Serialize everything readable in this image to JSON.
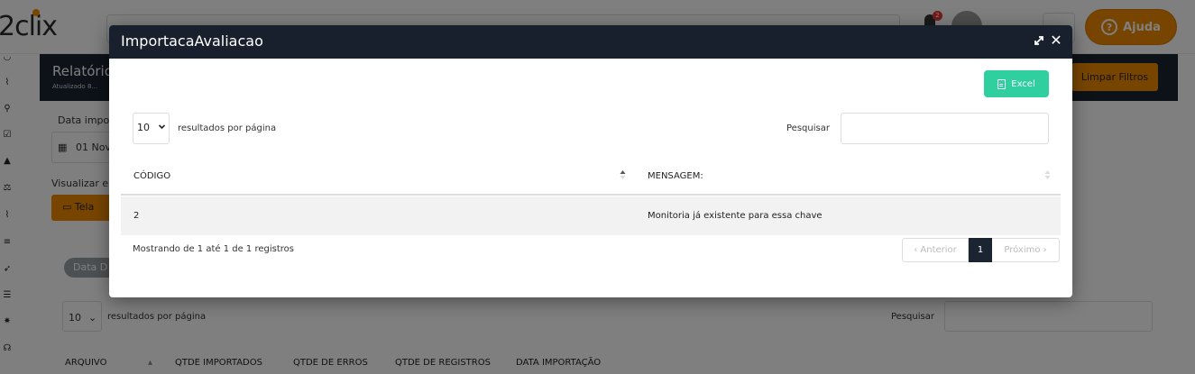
{
  "app": {
    "logo": "2clix",
    "help_label": "Ajuda",
    "notification_count": "2",
    "report_title": "Relatório",
    "report_subtitle": "Atualizado 8...",
    "clear_filters": "Limpar Filtros",
    "import_date_label": "Data impo",
    "date_value": "01 Nov",
    "view_label": "Visualizar em",
    "screen_button": "Tela",
    "pill_label": "Data D",
    "length_value": "10",
    "length_label": "resultados por página",
    "search_label": "Pesquisar",
    "columns": [
      "ARQUIVO",
      "QTDE IMPORTADOS",
      "QTDE DE ERROS",
      "QTDE DE REGISTROS",
      "DATA IMPORTAÇÃO"
    ]
  },
  "modal": {
    "title": "ImportacaAvaliacao",
    "excel_label": "Excel",
    "length_value": "10",
    "length_label": "resultados por página",
    "search_label": "Pesquisar",
    "search_value": "",
    "columns": [
      "CÓDIGO",
      "MENSAGEM:"
    ],
    "rows": [
      {
        "codigo": "2",
        "mensagem": "Monitoria já existente para essa chave"
      }
    ],
    "info": "Mostrando de 1 até 1 de 1 registros",
    "pager": {
      "prev": "‹ Anterior",
      "page": "1",
      "next": "Próximo ›"
    }
  },
  "colors": {
    "accent": "#f08a00",
    "header_dark": "#17202c",
    "excel": "#2fcfa0"
  }
}
